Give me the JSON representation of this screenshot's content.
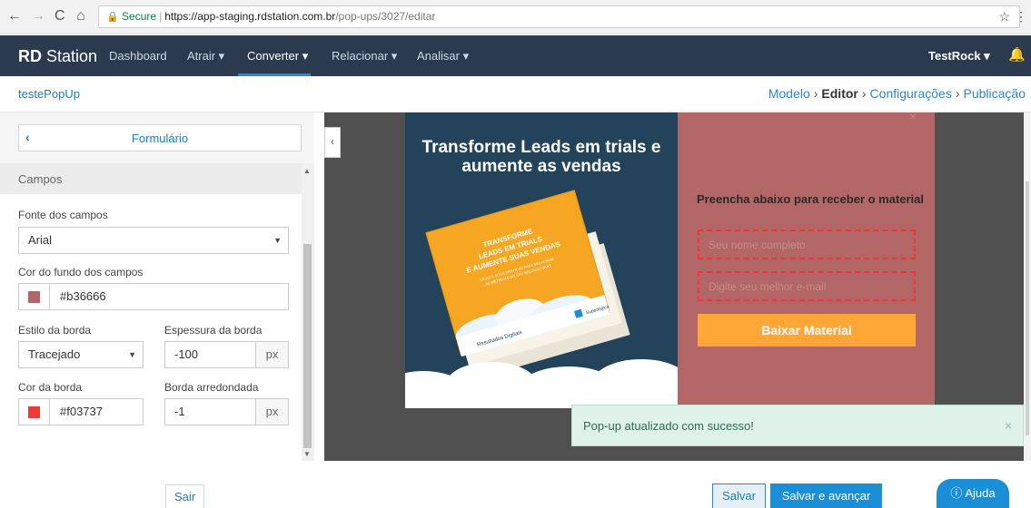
{
  "browser": {
    "back": "←",
    "forward": "→",
    "reload": "C",
    "home": "⌂",
    "secure_label": "Secure",
    "url_host": "https://app-staging.rdstation.com.br",
    "url_path": "/pop-ups/3027/editar"
  },
  "navbar": {
    "logo_bold": "RD",
    "logo_rest": " Station",
    "items": [
      "Dashboard",
      "Atrair ▾",
      "Converter ▾",
      "Relacionar ▾",
      "Analisar ▾"
    ],
    "user": "TestRock ▾"
  },
  "subheader": {
    "page_name": "testePopUp",
    "steps": [
      "Modelo",
      "Editor",
      "Configurações",
      "Publicação"
    ],
    "current_step": "Editor"
  },
  "panel": {
    "tab_title": "Formulário",
    "section_title": "Campos",
    "font_label": "Fonte dos campos",
    "font_value": "Arial",
    "bg_label": "Cor do fundo dos campos",
    "bg_value": "#b36666",
    "border_style_label": "Estilo da borda",
    "border_style_value": "Tracejado",
    "border_width_label": "Espessura da borda",
    "border_width_value": "-100",
    "border_width_unit": "px",
    "border_color_label": "Cor da borda",
    "border_color_value": "#f03737",
    "border_radius_label": "Borda arredondada",
    "border_radius_value": "-1",
    "border_radius_unit": "px"
  },
  "popup": {
    "headline": "Transforme Leads em trials e aumente as vendas",
    "cta_text": "Preencha abaixo para receber o material",
    "name_placeholder": "Seu nome completo",
    "email_placeholder": "Digite seu melhor e-mail",
    "button_label": "Baixar Material",
    "book_title": "TRANSFORME LEADS EM TRIALS E AUMENTE SUAS VENDAS",
    "book_subtitle": "DICAS E BOAS PRÁTICAS PARA MELHORAR AS MÉTRICAS DO SEU NEGÓCIO SAAS",
    "colors": {
      "left_bg": "#23435a",
      "right_bg": "#b36666",
      "button": "#ffa637",
      "field_border": "#f03737"
    }
  },
  "toast": {
    "message": "Pop-up atualizado com sucesso!",
    "close": "×"
  },
  "footer": {
    "exit": "Sair",
    "save": "Salvar",
    "save_next": "Salvar e avançar",
    "help": "Ajuda"
  }
}
